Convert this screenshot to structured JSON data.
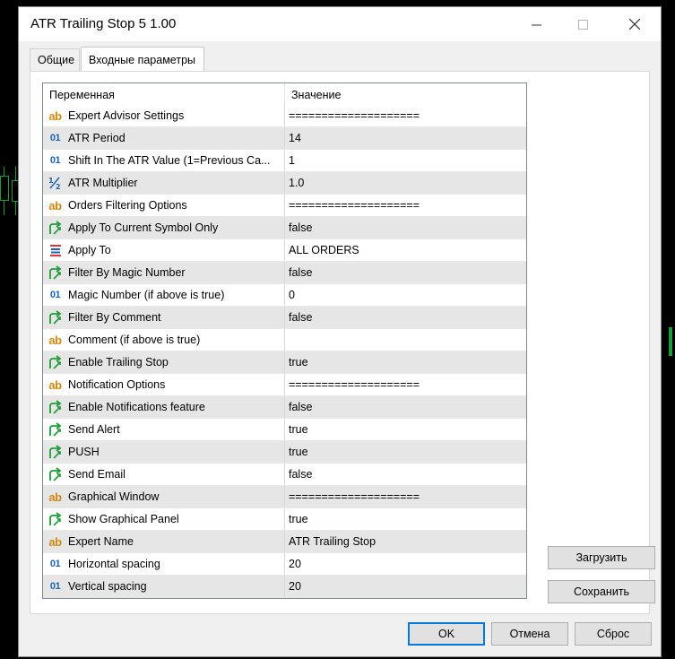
{
  "window": {
    "title": "ATR Trailing Stop 5 1.00",
    "controls": {
      "minimize": "—",
      "maximize": "☐",
      "close": "✕"
    }
  },
  "tabs": [
    {
      "label": "Общие",
      "active": false
    },
    {
      "label": "Входные параметры",
      "active": true
    }
  ],
  "grid": {
    "headers": {
      "variable": "Переменная",
      "value": "Значение"
    },
    "rows": [
      {
        "icon": "string-icon",
        "name": "Expert Advisor Settings",
        "value": "===================="
      },
      {
        "icon": "integer-icon",
        "name": "ATR Period",
        "value": "14"
      },
      {
        "icon": "integer-icon",
        "name": "Shift In The ATR Value (1=Previous Ca...",
        "value": "1"
      },
      {
        "icon": "double-icon",
        "name": "ATR Multiplier",
        "value": "1.0"
      },
      {
        "icon": "string-icon",
        "name": "Orders Filtering Options",
        "value": "===================="
      },
      {
        "icon": "bool-icon",
        "name": "Apply To Current Symbol Only",
        "value": "false"
      },
      {
        "icon": "enum-icon",
        "name": "Apply To",
        "value": "ALL ORDERS"
      },
      {
        "icon": "bool-icon",
        "name": "Filter By Magic Number",
        "value": "false"
      },
      {
        "icon": "integer-icon",
        "name": "Magic Number (if above is true)",
        "value": "0"
      },
      {
        "icon": "bool-icon",
        "name": "Filter By Comment",
        "value": "false"
      },
      {
        "icon": "string-icon",
        "name": "Comment (if above is true)",
        "value": ""
      },
      {
        "icon": "bool-icon",
        "name": "Enable Trailing Stop",
        "value": "true"
      },
      {
        "icon": "string-icon",
        "name": "Notification Options",
        "value": "===================="
      },
      {
        "icon": "bool-icon",
        "name": "Enable Notifications feature",
        "value": "false"
      },
      {
        "icon": "bool-icon",
        "name": "Send Alert",
        "value": "true"
      },
      {
        "icon": "bool-icon",
        "name": "PUSH",
        "value": "true"
      },
      {
        "icon": "bool-icon",
        "name": "Send  Email",
        "value": "false"
      },
      {
        "icon": "string-icon",
        "name": "Graphical Window",
        "value": "===================="
      },
      {
        "icon": "bool-icon",
        "name": "Show Graphical Panel",
        "value": "true"
      },
      {
        "icon": "string-icon",
        "name": "Expert Name",
        "value": "ATR Trailing Stop"
      },
      {
        "icon": "integer-icon",
        "name": "Horizontal spacing",
        "value": "20"
      },
      {
        "icon": "integer-icon",
        "name": "Vertical spacing",
        "value": "20"
      }
    ]
  },
  "buttons": {
    "load": "Загрузить",
    "save": "Сохранить",
    "ok": "OK",
    "cancel": "Отмена",
    "reset": "Сброс"
  },
  "colors": {
    "string_icon": "#d08a14",
    "integer_icon": "#1f63b0",
    "bool_icon": "#1f9a3a",
    "enum_icon_red": "#d9363e",
    "enum_icon_blue": "#1f63b0",
    "primary_border": "#0078d7"
  }
}
